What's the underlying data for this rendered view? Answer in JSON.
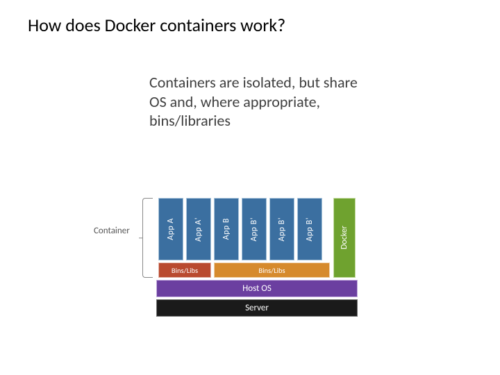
{
  "title": "How does Docker  containers work?",
  "description": "Containers are isolated, but share OS and, where appropriate, bins/libraries",
  "diagram": {
    "container_label": "Container",
    "apps": [
      "App A",
      "App A'",
      "App B",
      "App B'",
      "App B'",
      "App B'"
    ],
    "docker": "Docker",
    "bins": {
      "left": "Bins/Libs",
      "right": "Bins/Libs"
    },
    "hostos": "Host OS",
    "server": "Server"
  }
}
